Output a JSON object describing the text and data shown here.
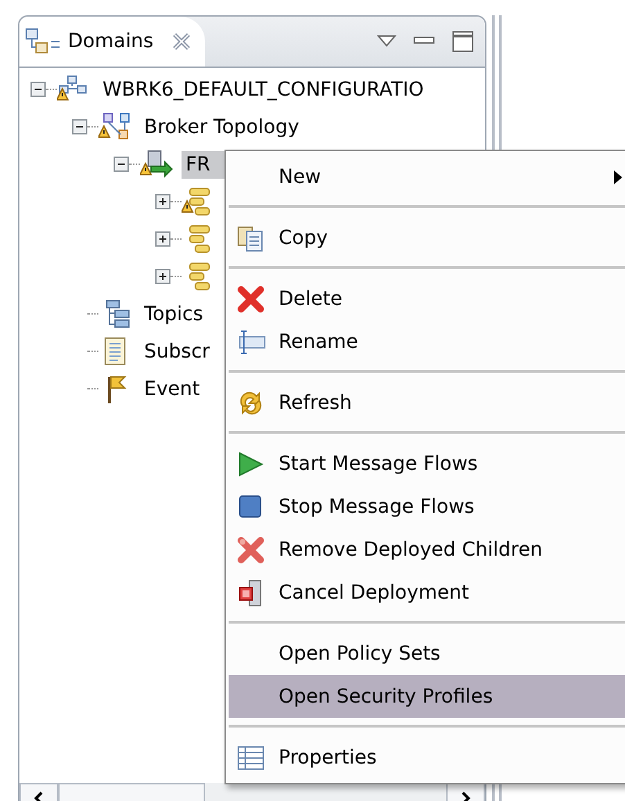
{
  "view": {
    "title": "Domains"
  },
  "tree": [
    {
      "label": "WBRK6_DEFAULT_CONFIGURATIO",
      "kind": "domain",
      "expanded": true,
      "warning": true,
      "selected": false,
      "children": [
        {
          "label": "Broker Topology",
          "kind": "topology",
          "expanded": true,
          "warning": true,
          "selected": false,
          "children": [
            {
              "label": "FR",
              "kind": "broker",
              "expanded": true,
              "warning": true,
              "selected": true,
              "children": [
                {
                  "kind": "group",
                  "expanded": false,
                  "warning": true
                },
                {
                  "kind": "group",
                  "expanded": false,
                  "warning": false
                },
                {
                  "kind": "group",
                  "expanded": false,
                  "warning": false
                }
              ]
            }
          ]
        },
        {
          "label": "Topics",
          "kind": "topics",
          "warning": false,
          "selected": false
        },
        {
          "label": "Subscr",
          "kind": "subscriptions",
          "warning": false,
          "selected": false
        },
        {
          "label": "Event",
          "kind": "events",
          "warning": false,
          "selected": false
        }
      ]
    }
  ],
  "context_menu": [
    {
      "kind": "plain",
      "label": "New",
      "submenu": true,
      "selected": false
    },
    {
      "kind": "separator"
    },
    {
      "kind": "copy",
      "label": "Copy",
      "selected": false
    },
    {
      "kind": "separator"
    },
    {
      "kind": "delete",
      "label": "Delete",
      "selected": false
    },
    {
      "kind": "rename",
      "label": "Rename",
      "selected": false
    },
    {
      "kind": "separator"
    },
    {
      "kind": "refresh",
      "label": "Refresh",
      "selected": false
    },
    {
      "kind": "separator"
    },
    {
      "kind": "start",
      "label": "Start Message Flows",
      "selected": false
    },
    {
      "kind": "stop",
      "label": "Stop Message Flows",
      "selected": false
    },
    {
      "kind": "remove",
      "label": "Remove Deployed Children",
      "selected": false
    },
    {
      "kind": "cancel",
      "label": "Cancel Deployment",
      "selected": false
    },
    {
      "kind": "separator"
    },
    {
      "kind": "plain",
      "label": "Open Policy Sets",
      "selected": false
    },
    {
      "kind": "plain",
      "label": "Open Security Profiles",
      "selected": true
    },
    {
      "kind": "separator"
    },
    {
      "kind": "properties",
      "label": "Properties",
      "selected": false
    }
  ]
}
